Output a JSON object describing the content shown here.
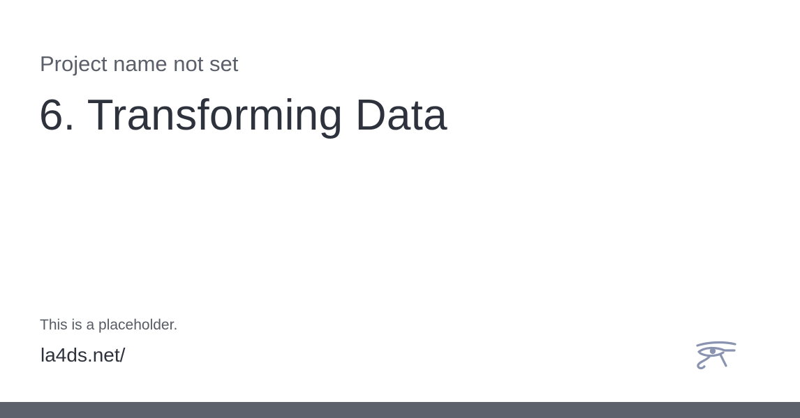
{
  "card": {
    "project_name": "Project name not set",
    "title": "6. Transforming Data",
    "description": "This is a placeholder.",
    "url": "la4ds.net/",
    "logo_icon": "eye-of-horus-icon"
  },
  "colors": {
    "title_text": "#2d323c",
    "muted_text": "#5b5f69",
    "logo": "#8a93b0",
    "bottom_bar": "#5c616b",
    "background": "#ffffff"
  }
}
